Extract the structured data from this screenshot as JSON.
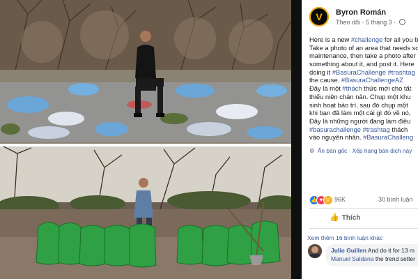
{
  "photo": {
    "top_alt": "",
    "bottom_alt": ""
  },
  "post": {
    "author": "Byron Román",
    "avatar_letter": "V",
    "follow": "Theo dõi",
    "date": "5 tháng 3",
    "body_lines": [
      [
        {
          "t": "Here is a new "
        },
        {
          "t": "#challenge",
          "tag": true
        },
        {
          "t": " for all you b"
        }
      ],
      [
        {
          "t": "Take a photo of an area that needs so"
        }
      ],
      [
        {
          "t": "maintenance, then take a photo after"
        }
      ],
      [
        {
          "t": "something about it, and post it. Here"
        }
      ],
      [
        {
          "t": "doing it "
        },
        {
          "t": "#BasuraChallenge",
          "tag": true
        },
        {
          "t": " "
        },
        {
          "t": "#trashtag",
          "tag": true
        }
      ],
      [
        {
          "t": "the cause. "
        },
        {
          "t": "#BasuraChallengeAZ",
          "tag": true
        }
      ],
      [
        {
          "t": "Đây là một "
        },
        {
          "t": "#thách",
          "tag": true
        },
        {
          "t": " thức mới cho tất"
        }
      ],
      [
        {
          "t": "thiếu niên chán nản. Chụp một khu"
        }
      ],
      [
        {
          "t": "sinh hoạt bảo trì, sau đó chụp một"
        }
      ],
      [
        {
          "t": "khi bạn đã làm một cái gì đó về nó,"
        }
      ],
      [
        {
          "t": "Đây là những người đang làm điều"
        }
      ],
      [
        {
          "t": "#basurachallenge",
          "tag": true
        },
        {
          "t": " "
        },
        {
          "t": "#trashtag",
          "tag": true
        },
        {
          "t": " thách"
        }
      ],
      [
        {
          "t": "vào nguyên nhân. "
        },
        {
          "t": "#BasuraChalleng",
          "tag": true
        }
      ]
    ],
    "hide_original": "Ẩn bản gốc",
    "separator": "·",
    "rate_translation": "Xếp hạng bản dịch này",
    "reaction_count": "96K",
    "comment_count": "30 bình luận",
    "like_label": "Thích",
    "more_comments": "Xem thêm 16 bình luận khác",
    "comment": {
      "name": "Julio Guillen",
      "text": "And do it for 13 m",
      "reply_name": "Manuel Saldana",
      "reply_text": "the trend setter"
    }
  },
  "colors": {
    "link": "#385898",
    "muted": "#606770",
    "like_blue": "#1877f2",
    "love_red": "#f33e58",
    "haha_yellow": "#f7b125",
    "bag_green": "#2fa043"
  },
  "icons": [
    "globe-icon",
    "like-reaction-icon",
    "love-reaction-icon",
    "haha-reaction-icon",
    "thumbs-up-icon",
    "hide-icon"
  ]
}
